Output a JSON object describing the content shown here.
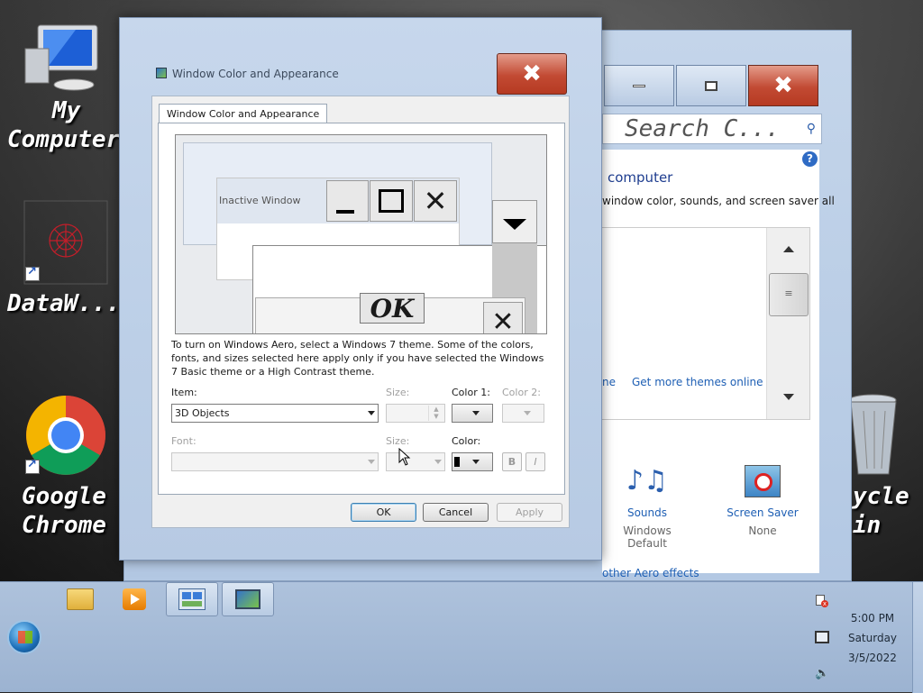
{
  "desktop": {
    "icons": [
      {
        "id": "my-computer",
        "label": "My Computer"
      },
      {
        "id": "dataw",
        "label": "DataW..."
      },
      {
        "id": "google-chrome",
        "label_line1": "Google",
        "label_line2": "Chrome"
      },
      {
        "id": "recycle-bin",
        "label_line1": "ycle",
        "label_line2": "in"
      }
    ]
  },
  "control_panel": {
    "search_placeholder": "Search C...",
    "heading": "computer",
    "description": "window color, sounds, and screen saver all",
    "link_partial": "ne",
    "get_more_themes": "Get more themes online",
    "sounds_label": "Sounds",
    "sounds_value": "Windows Default",
    "screen_saver_label": "Screen Saver",
    "screen_saver_value": "None",
    "aero_link": "other Aero effects"
  },
  "dialog": {
    "title": "Window Color and Appearance",
    "tab_label": "Window Color and Appearance",
    "preview": {
      "inactive_window": "Inactive Window",
      "ok_text": "OK"
    },
    "info_text": "To turn on Windows Aero, select a Windows 7 theme.  Some of the colors, fonts, and sizes selected here apply only if you have selected the Windows 7 Basic theme or a High Contrast theme.",
    "item_label": "Item:",
    "item_value": "3D Objects",
    "size_label": "Size:",
    "color1_label": "Color 1:",
    "color2_label": "Color 2:",
    "font_label": "Font:",
    "font_value": "",
    "size2_label": "Size:",
    "color_label": "Color:",
    "bold_label": "B",
    "italic_label": "I",
    "ok_label": "OK",
    "cancel_label": "Cancel",
    "apply_label": "Apply"
  },
  "taskbar": {
    "time": "5:00 PM",
    "day": "Saturday",
    "date": "3/5/2022"
  }
}
